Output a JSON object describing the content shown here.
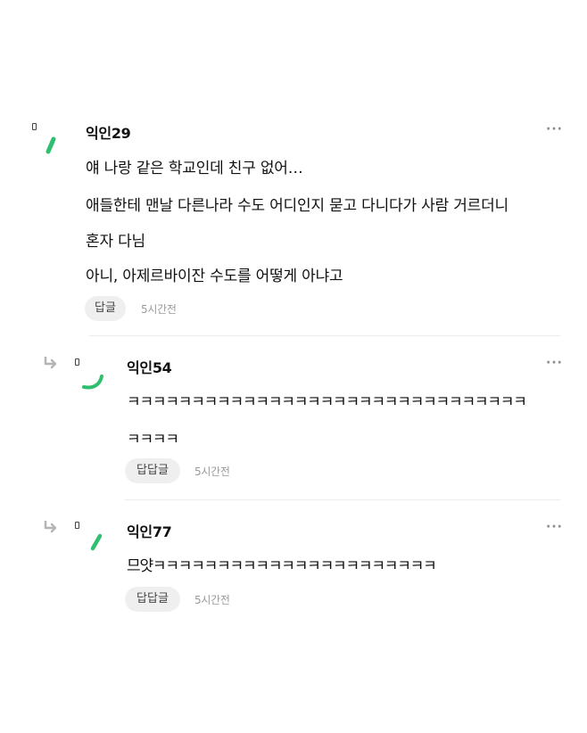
{
  "comments": [
    {
      "nickname": "익인29",
      "more": "···",
      "lines": [
        "얘 나랑 같은 학교인데 친구 없어…",
        "애들한테 맨날 다른나라 수도 어디인지 묻고 다니다가 사람 거르더니",
        "혼자 다님",
        "아니, 아제르바이잔 수도를 어떻게 아냐고"
      ],
      "reply_label": "답글",
      "time": "5시간전"
    },
    {
      "nickname": "익인54",
      "more": "···",
      "lines": [
        "ㅋㅋㅋㅋㅋㅋㅋㅋㅋㅋㅋㅋㅋㅋㅋㅋㅋㅋㅋㅋㅋㅋㅋㅋㅋㅋㅋㅋㅋㅋㅋ",
        "ㅋㅋㅋㅋ"
      ],
      "reply_label": "답답글",
      "time": "5시간전"
    },
    {
      "nickname": "익인77",
      "more": "···",
      "lines": [
        "므얏ㅋㅋㅋㅋㅋㅋㅋㅋㅋㅋㅋㅋㅋㅋㅋㅋㅋㅋㅋㅋㅋㅋ"
      ],
      "reply_label": "답답글",
      "time": "5시간전"
    }
  ],
  "colors": {
    "accent_green": "#2fbf6f",
    "reply_bg": "#efefef",
    "muted": "#9a9a9a"
  },
  "icons": {
    "avatar": "green-stroke-avatar-icon",
    "reply": "reply-arrow-icon",
    "more": "more-dots-icon"
  }
}
